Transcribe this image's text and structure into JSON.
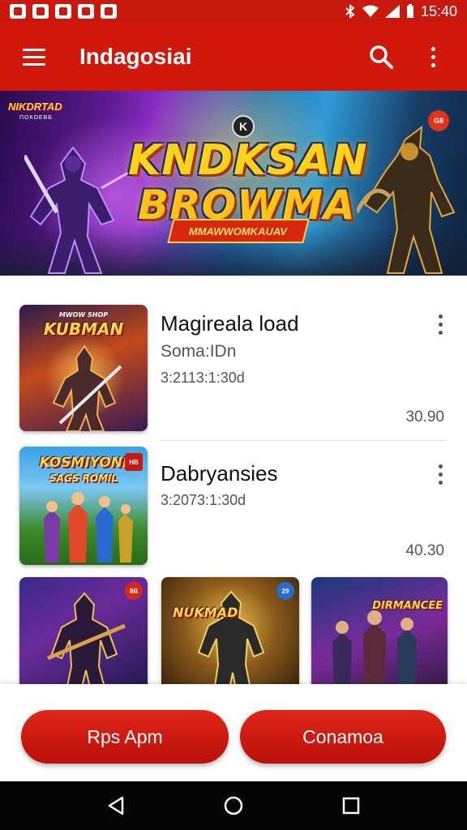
{
  "status_bar": {
    "time": "15:40",
    "notification_icons": [
      "app-icon",
      "file-icon",
      "mail-icon",
      "camera-icon",
      "media-icon"
    ],
    "system_icons": [
      "bluetooth-icon",
      "wifi-icon",
      "signal-icon",
      "battery-icon"
    ]
  },
  "app_bar": {
    "title": "Indagosiai",
    "accent_color": "#d0180c"
  },
  "hero": {
    "title_line1": "KNDKSAN",
    "title_line2": "BROWMA",
    "ribbon": "MMAWWOMKAUAV",
    "tag_left": "NIKDRTAD",
    "tag_left_sub": "ПОКОЕВБ",
    "corner_badge": "G8",
    "logo_mark": "K"
  },
  "list": {
    "items": [
      {
        "title": "Magireala load",
        "subtitle": "Soma:IDn",
        "meta": "3:2113:1:30d",
        "price": "30.90",
        "thumb_title": "KUBMAN",
        "thumb_sub": "MWOW SHOP"
      },
      {
        "title": "Dabryansies",
        "meta": "3:2073:1:30d",
        "price": "40.30",
        "thumb_title": "KOSMIYONI",
        "thumb_sub": "SAGS ROMIL",
        "thumb_badge": "HB"
      }
    ],
    "grid_tiles": [
      {
        "chip": "8B"
      },
      {
        "label": "NUKMAD",
        "chip": "29"
      },
      {
        "label": "DIRMANCEE"
      }
    ]
  },
  "actions": {
    "primary_left": "Rps Apm",
    "primary_right": "Conamoa"
  },
  "nav_bar": {
    "buttons": [
      "back-icon",
      "home-icon",
      "recents-icon"
    ]
  }
}
